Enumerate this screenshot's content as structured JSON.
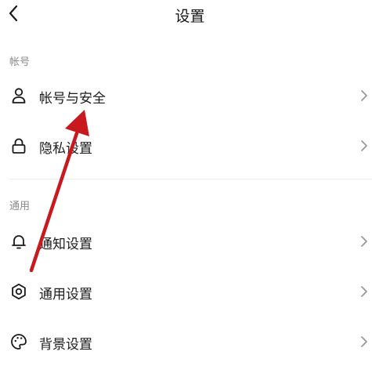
{
  "header": {
    "title": "设置",
    "back_icon": "chevron-left-icon"
  },
  "sections": [
    {
      "title": "帐号",
      "items": [
        {
          "label": "帐号与安全",
          "icon": "user-icon"
        },
        {
          "label": "隐私设置",
          "icon": "lock-icon"
        }
      ]
    },
    {
      "title": "通用",
      "items": [
        {
          "label": "通知设置",
          "icon": "bell-icon"
        },
        {
          "label": "通用设置",
          "icon": "gear-icon"
        },
        {
          "label": "背景设置",
          "icon": "palette-icon"
        }
      ]
    }
  ],
  "colors": {
    "annotation_arrow": "#c8191f",
    "section_title": "#8a8a8a",
    "chevron": "#9a9a9a"
  }
}
